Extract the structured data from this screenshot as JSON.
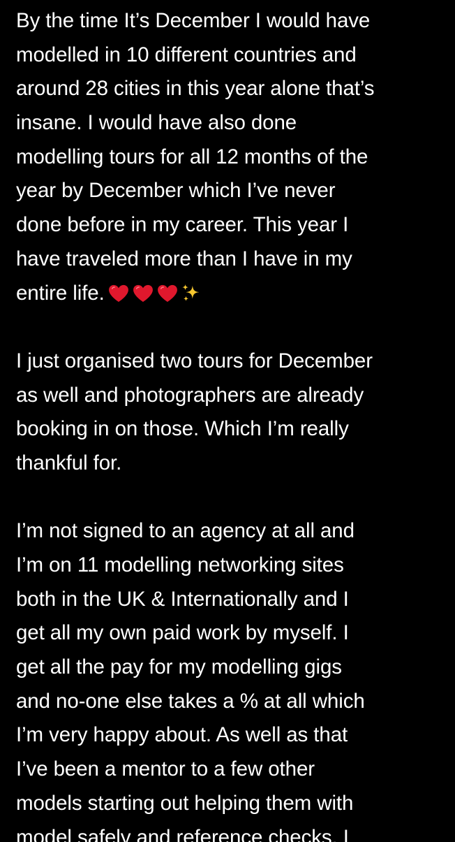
{
  "note": {
    "paragraph1": [
      "By the time It’s December I would have",
      "modelled in 10 different countries and",
      "around 28 cities in this year alone that’s",
      "insane. I would have also done",
      "modelling tours for all 12 months of the",
      "year by December which I’ve never",
      "done before in my career. This year I",
      "have traveled more than I have in my",
      "entire life."
    ],
    "paragraph1_emojis": [
      "heart-emoji",
      "heart-emoji",
      "heart-emoji",
      "sparkles-emoji"
    ],
    "paragraph2": [
      "I just organised two tours for December",
      "as well and photographers are already",
      "booking in on those. Which I’m really",
      "thankful for."
    ],
    "paragraph3": [
      "I’m not signed to an agency at all and",
      "I’m on 11 modelling networking sites",
      "both in the UK & Internationally and I",
      "get all my own paid work by myself. I",
      "get all the pay for my modelling gigs",
      "and no-one else takes a % at all which",
      "I’m very happy about. As well as that",
      "I’ve been a mentor to a few other",
      "models starting out helping them with",
      "model safely and reference checks. I"
    ]
  },
  "colors": {
    "background": "#000000",
    "text": "#ffffff",
    "heart": "#e0182d",
    "sparkles": "#f7c730"
  }
}
